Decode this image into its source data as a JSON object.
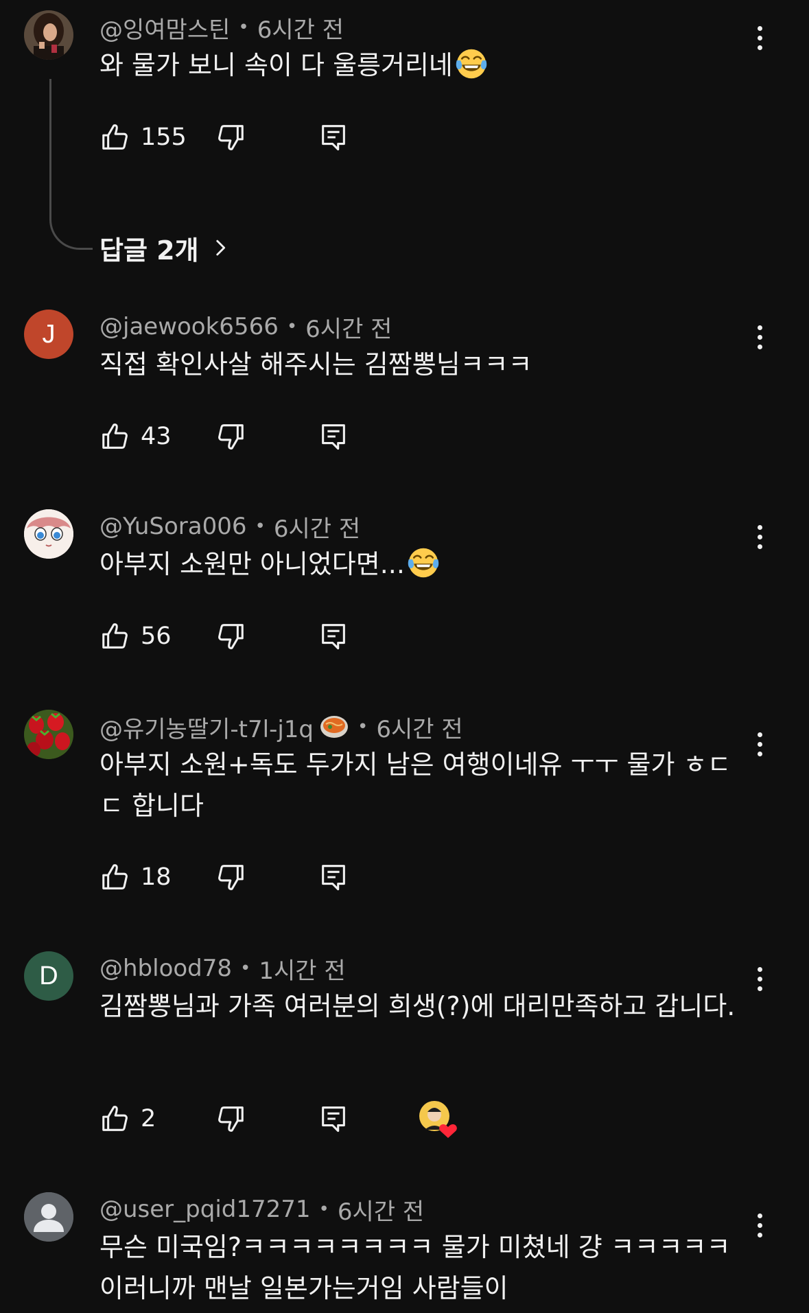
{
  "comments": [
    {
      "author": "@잉여맘스틴",
      "time": "6시간 전",
      "text": "와 물가 보니 속이 다 울릉거리네",
      "text_emoji": "face-with-tears-of-joy",
      "likes": "155",
      "replies_label": "답글 2개"
    },
    {
      "author": "@jaewook6566",
      "time": "6시간 전",
      "avatar_letter": "J",
      "avatar_color": "#c0462b",
      "text": "직접 확인사살 해주시는 김짬뽕님ㅋㅋㅋ",
      "likes": "43"
    },
    {
      "author": "@YuSora006",
      "time": "6시간 전",
      "text": "아부지 소원만 아니었다면...",
      "text_emoji": "face-with-tears-of-joy",
      "likes": "56"
    },
    {
      "author": "@유기농딸기-t7l-j1q",
      "author_badge": "ramen-bowl-emoji",
      "time": "6시간 전",
      "text": "아부지 소원+독도 두가지 남은 여행이네유 ㅜㅜ 물가 ㅎㄷㄷ 합니다",
      "likes": "18"
    },
    {
      "author": "@hblood78",
      "time": "1시간 전",
      "avatar_letter": "D",
      "avatar_color": "#2e5c46",
      "text": "김짬뽕님과 가족 여러분의 희생(?)에 대리만족하고 갑니다.",
      "likes": "2",
      "creator_heart": true
    },
    {
      "author": "@user_pqid17271",
      "time": "6시간 전",
      "text": "무슨 미국임?ㅋㅋㅋㅋㅋㅋㅋㅋ 물가 미쳤네 걍 ㅋㅋㅋㅋㅋ 이러니까 맨날 일본가는거임 사람들이"
    }
  ],
  "icons": {
    "like": "thumbs-up-icon",
    "dislike": "thumbs-down-icon",
    "reply": "reply-icon",
    "more": "more-vertical-icon",
    "chevron": "chevron-right-icon"
  },
  "colors": {
    "background": "#0f0f0f",
    "text_primary": "#f1f1f1",
    "text_secondary": "#aaaaaa"
  }
}
